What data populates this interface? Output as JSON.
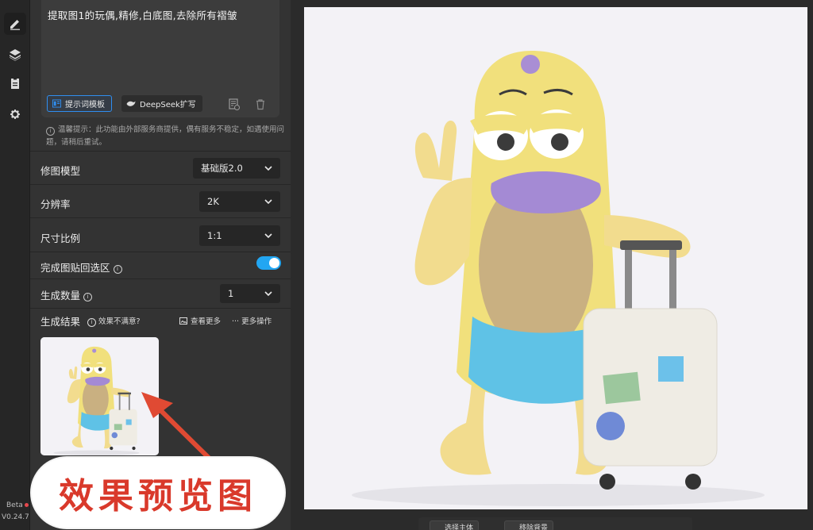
{
  "prompt": {
    "text": "提取图1的玩偶,精修,白底图,去除所有褶皱",
    "template_button": "提示词模板",
    "deepseek_button": "DeepSeek扩写"
  },
  "tip": "温馨提示：此功能由外部服务商提供，偶有服务不稳定，如遇使用问题，请稍后重试。",
  "settings": {
    "model": {
      "label": "修图模型",
      "value": "基础版2.0"
    },
    "resolution": {
      "label": "分辨率",
      "value": "2K"
    },
    "ratio": {
      "label": "尺寸比例",
      "value": "1:1"
    },
    "paste_back": {
      "label": "完成图贴回选区",
      "enabled": true
    },
    "count": {
      "label": "生成数量",
      "value": "1"
    }
  },
  "results": {
    "label": "生成结果",
    "unsatisfied": "效果不满意?",
    "view_more": "查看更多",
    "more_ops": "··· 更多操作"
  },
  "annotation": "效果预览图",
  "app": {
    "beta": "Beta",
    "version": "V0.24.7"
  },
  "bottom_toolbar": {
    "select_main": "选择主体",
    "remove_bg": "移除背景"
  },
  "colors": {
    "accent": "#22a6f2",
    "annotation": "#d9392b",
    "panel_bg": "#333333",
    "canvas_bg": "#f3f2f6"
  },
  "icons": [
    "edit-icon",
    "layers-icon",
    "clipboard-icon",
    "gear-icon",
    "info-icon",
    "chevron-down-icon",
    "trash-icon",
    "history-icon",
    "deepseek-whale-icon",
    "template-icon"
  ]
}
